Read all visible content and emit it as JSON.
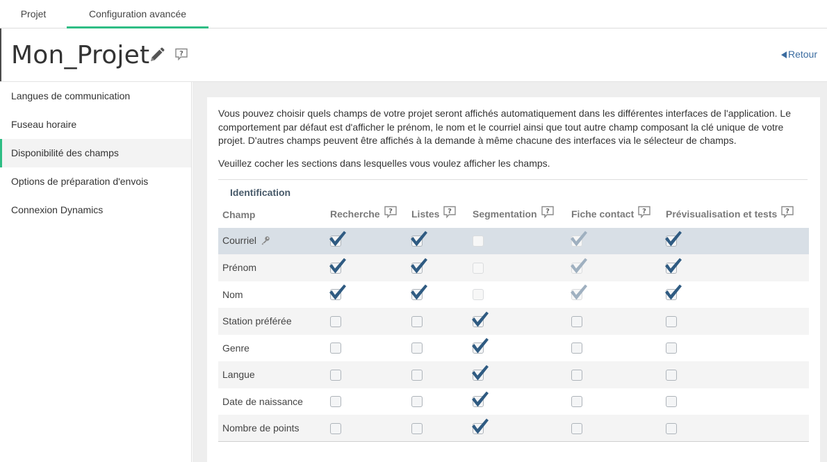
{
  "tabs": [
    {
      "label": "Projet",
      "active": false
    },
    {
      "label": "Configuration avancée",
      "active": true
    }
  ],
  "header": {
    "title": "Mon_Projet",
    "back_label": "Retour"
  },
  "sidebar": {
    "items": [
      {
        "label": "Langues de communication"
      },
      {
        "label": "Fuseau horaire"
      },
      {
        "label": "Disponibilité des champs",
        "active": true
      },
      {
        "label": "Options de préparation d'envois"
      },
      {
        "label": "Connexion Dynamics"
      }
    ]
  },
  "main": {
    "description": "Vous pouvez choisir quels champs de votre projet seront affichés automatiquement dans les différentes interfaces de l'application. Le comportement par défaut est d'afficher le prénom, le nom et le courriel ainsi que tout autre champ composant la clé unique de votre projet. D'autres champs peuvent être affichés à la demande à même chacune des interfaces via le sélecteur de champs.",
    "instruction": "Veuillez cocher les sections dans lesquelles vous voulez afficher les champs.",
    "section_title": "Identification",
    "columns": [
      "Champ",
      "Recherche",
      "Listes",
      "Segmentation",
      "Fiche contact",
      "Prévisualisation et tests"
    ],
    "rows": [
      {
        "name": "Courriel",
        "key": true,
        "states": [
          "checked",
          "checked",
          "disabled",
          "checked-disabled",
          "checked"
        ]
      },
      {
        "name": "Prénom",
        "key": false,
        "states": [
          "checked",
          "checked",
          "disabled",
          "checked-disabled",
          "checked"
        ]
      },
      {
        "name": "Nom",
        "key": false,
        "states": [
          "checked",
          "checked",
          "disabled",
          "checked-disabled",
          "checked"
        ]
      },
      {
        "name": "Station préférée",
        "key": false,
        "states": [
          "unchecked",
          "unchecked",
          "checked",
          "unchecked",
          "unchecked"
        ]
      },
      {
        "name": "Genre",
        "key": false,
        "states": [
          "unchecked",
          "unchecked",
          "checked",
          "unchecked",
          "unchecked"
        ]
      },
      {
        "name": "Langue",
        "key": false,
        "states": [
          "unchecked",
          "unchecked",
          "checked",
          "unchecked",
          "unchecked"
        ]
      },
      {
        "name": "Date de naissance",
        "key": false,
        "states": [
          "unchecked",
          "unchecked",
          "checked",
          "unchecked",
          "unchecked"
        ]
      },
      {
        "name": "Nombre de points",
        "key": false,
        "states": [
          "unchecked",
          "unchecked",
          "checked",
          "unchecked",
          "unchecked"
        ]
      }
    ]
  },
  "colors": {
    "accent_green": "#2ebd84",
    "check_blue": "#2f5b82",
    "check_disabled": "#9fb0c0",
    "link_blue": "#3b6ca0",
    "selected_row": "#d8dfe6"
  },
  "icons": {
    "edit": "pencil-icon",
    "help": "question-mark-icon",
    "key": "key-icon",
    "back": "triangle-left-icon",
    "check": "checkmark-icon"
  }
}
